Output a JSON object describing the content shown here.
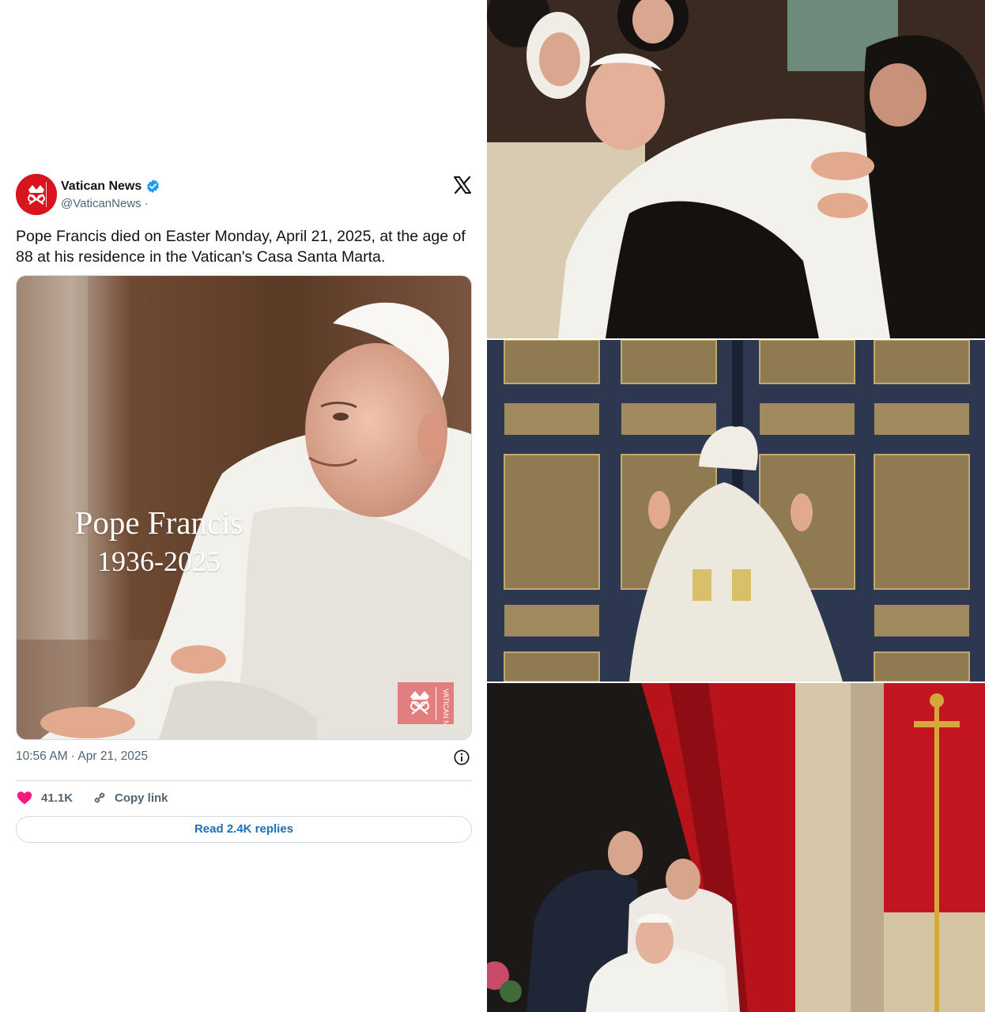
{
  "tweet": {
    "display_name": "Vatican News",
    "handle": "@VaticanNews ·",
    "text": "Pope Francis died on Easter Monday, April 21, 2025, at the age of 88 at his residence in the Vatican's Casa Santa Marta.",
    "image": {
      "caption_name": "Pope Francis",
      "caption_years": "1936-2025",
      "watermark_text": "VATICAN NEWS"
    },
    "timestamp": "10:56 AM · Apr 21, 2025",
    "likes": "41.1K",
    "copy_link_label": "Copy link",
    "read_replies_label": "Read 2.4K replies"
  },
  "icons": {
    "verified": "verified-badge-icon",
    "x_logo": "x-logo-icon",
    "info": "info-icon",
    "like": "heart-icon",
    "link": "link-icon"
  },
  "colors": {
    "verified_blue": "#1d9bf0",
    "heart_pink": "#f91880",
    "link_blue": "#1d6fb8",
    "vatican_red": "#d8141e"
  }
}
